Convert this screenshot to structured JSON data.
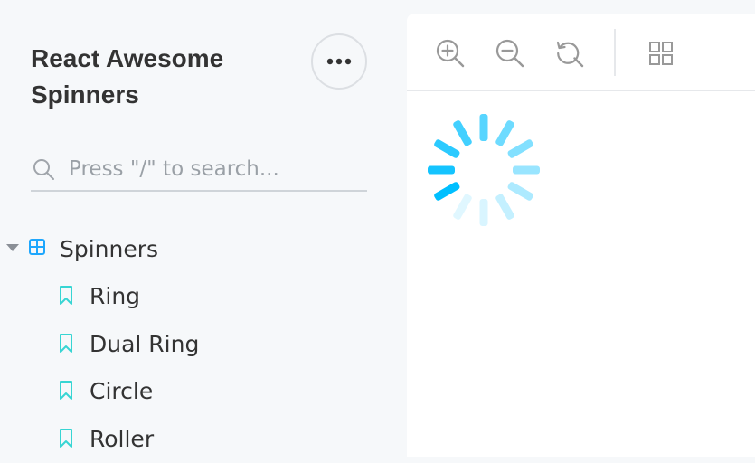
{
  "sidebar": {
    "brand_title": "React Awesome Spinners",
    "menu_button_icon": "more-horizontal-icon",
    "search": {
      "placeholder": "Press \"/\" to search...",
      "value": ""
    },
    "tree": {
      "group_label": "Spinners",
      "group_icon": "grid-icon",
      "group_expanded": true,
      "items": [
        {
          "label": "Ring",
          "icon": "bookmark-icon"
        },
        {
          "label": "Dual Ring",
          "icon": "bookmark-icon"
        },
        {
          "label": "Circle",
          "icon": "bookmark-icon"
        },
        {
          "label": "Roller",
          "icon": "bookmark-icon"
        }
      ]
    }
  },
  "toolbar": {
    "buttons": [
      {
        "icon": "zoom-in-icon"
      },
      {
        "icon": "zoom-out-icon"
      },
      {
        "icon": "reset-zoom-icon"
      },
      {
        "icon": "grid-background-icon"
      }
    ]
  },
  "preview": {
    "component": "Spinner",
    "spinner_color": "#00bfff",
    "segments": 12
  },
  "colors": {
    "sidebar_bg": "#f6f8fa",
    "accent_blue": "#1ea7fd",
    "bookmark_teal": "#37d5d3",
    "spinner_blue": "#00bfff"
  }
}
